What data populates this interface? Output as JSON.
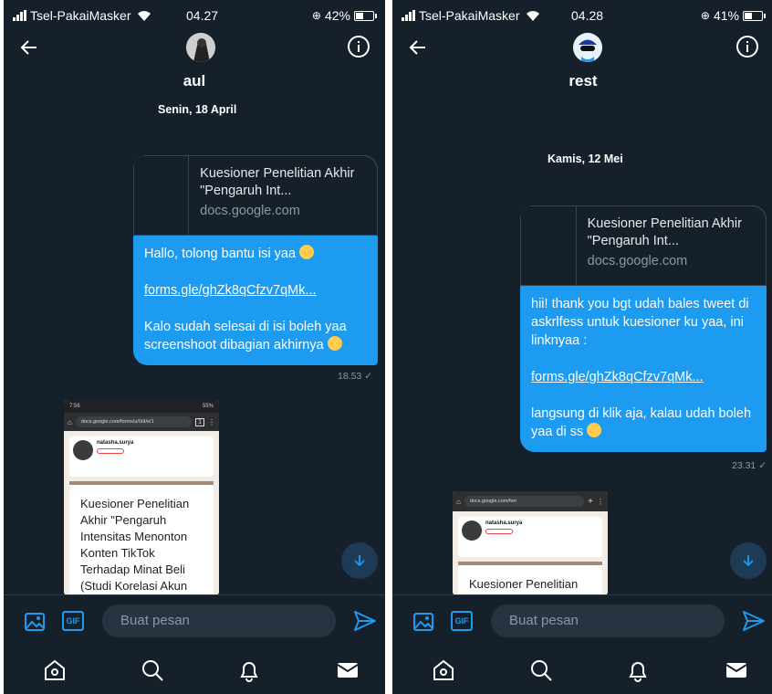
{
  "left": {
    "status": {
      "carrier": "Tsel-PakaiMasker",
      "time": "04.27",
      "battery": "42%",
      "battery_level": 0.42
    },
    "contact": {
      "name": "aul"
    },
    "date_separator": "Senin, 18 April",
    "message": {
      "card_title": "Kuesioner Penelitian Akhir \"Pengaruh Int...",
      "card_domain": "docs.google.com",
      "lines": [
        "Hallo, tolong bantu isi yaa",
        "forms.gle/ghZk8qCfzv7qMk...",
        "Kalo sudah selesai di isi boleh yaa screenshoot dibagian akhirnya"
      ],
      "time": "18.53"
    },
    "screenshot": {
      "status_time": "7:56",
      "status_right": "55%",
      "url": "docs.google.com/forms/u/0/d/e/1",
      "tab_count": "1",
      "profile_handle": "natasha.surya",
      "form_text": "Kuesioner Penelitian Akhir \"Pengaruh Intensitas Menonton Konten TikTok Terhadap Minat Beli (Studi Korelasi Akun @natasha.surya di"
    },
    "composer": {
      "gif_label": "GIF",
      "placeholder": "Buat pesan"
    }
  },
  "right": {
    "status": {
      "carrier": "Tsel-PakaiMasker",
      "time": "04.28",
      "battery": "41%",
      "battery_level": 0.41
    },
    "contact": {
      "name": "rest"
    },
    "date_separator": "Kamis, 12 Mei",
    "message": {
      "card_title": "Kuesioner Penelitian Akhir \"Pengaruh Int...",
      "card_domain": "docs.google.com",
      "lines": [
        "hii! thank you bgt udah bales tweet di askrlfess untuk kuesioner ku yaa, ini linknyaa :",
        "forms.gle/ghZk8qCfzv7qMk...",
        "langsung di klik aja, kalau udah boleh yaa di ss"
      ],
      "time": "23.31"
    },
    "screenshot": {
      "url": "docs.google.com/forr",
      "profile_handle": "natasha.surya",
      "form_text": "Kuesioner Penelitian Akhir \"Pengaruh"
    },
    "composer": {
      "gif_label": "GIF",
      "placeholder": "Buat pesan"
    }
  },
  "icons": {
    "back": "arrow-left-icon",
    "info": "info-icon",
    "media": "image-icon",
    "send": "send-icon",
    "home": "home-icon",
    "search": "search-icon",
    "notifications": "bell-icon",
    "messages": "mail-icon",
    "scroll": "arrow-down-icon"
  },
  "colors": {
    "background": "#15202b",
    "accent": "#1d9bf0",
    "bubble": "#1d9bf0"
  }
}
